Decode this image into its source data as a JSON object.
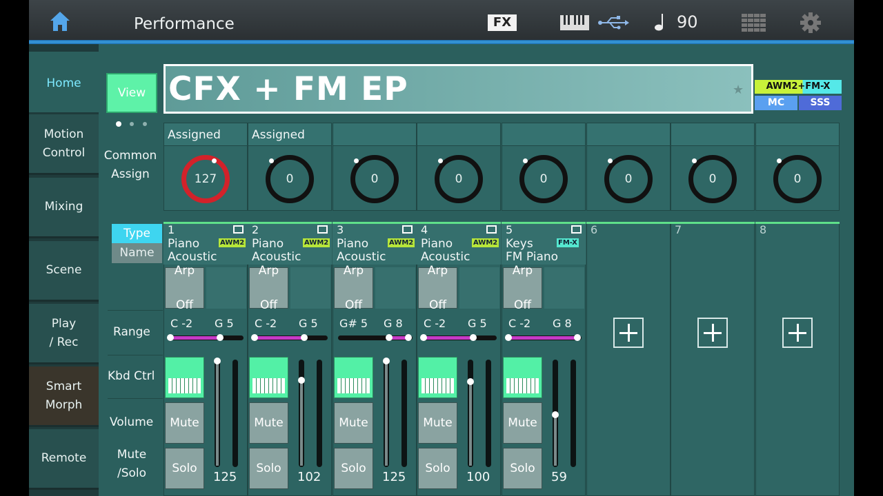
{
  "header": {
    "title": "Performance",
    "fx_label": "FX",
    "tempo_icon": "quarter-note-icon",
    "tempo_value": "90"
  },
  "nav": [
    {
      "label": "Home",
      "active": true
    },
    {
      "label": "Motion\nControl"
    },
    {
      "label": "Mixing"
    },
    {
      "label": "Scene"
    },
    {
      "label": "Play\n/ Rec"
    },
    {
      "label": "Smart\nMorph"
    },
    {
      "label": "Remote"
    }
  ],
  "view_button": "View",
  "performance_name": "CFX + FM EP",
  "engine_badges": {
    "line1": "AWM2+FM-X",
    "mc": "MC",
    "sss": "SSS"
  },
  "row_labels": {
    "common_assign": "Common\nAssign",
    "type": "Type",
    "name": "Name",
    "range": "Range",
    "kbd_ctrl": "Kbd Ctrl",
    "volume": "Volume",
    "mute_solo": "Mute\n/Solo"
  },
  "knobs": [
    {
      "assigned": "Assigned",
      "value": "127"
    },
    {
      "assigned": "Assigned",
      "value": "0"
    },
    {
      "assigned": "",
      "value": "0"
    },
    {
      "assigned": "",
      "value": "0"
    },
    {
      "assigned": "",
      "value": "0"
    },
    {
      "assigned": "",
      "value": "0"
    },
    {
      "assigned": "",
      "value": "0"
    },
    {
      "assigned": "",
      "value": "0"
    }
  ],
  "parts": [
    {
      "num": "1",
      "category": "Piano",
      "sub": "Acoustic",
      "engine": "AWM2",
      "arp_line1": "Arp",
      "arp_line2": "Off",
      "range_low": "C -2",
      "range_high": "G 5",
      "mute": "Mute",
      "solo": "Solo",
      "volume": "125",
      "volume_level": 125
    },
    {
      "num": "2",
      "category": "Piano",
      "sub": "Acoustic",
      "engine": "AWM2",
      "arp_line1": "Arp",
      "arp_line2": "Off",
      "range_low": "C -2",
      "range_high": "G 5",
      "mute": "Mute",
      "solo": "Solo",
      "volume": "102",
      "volume_level": 102
    },
    {
      "num": "3",
      "category": "Piano",
      "sub": "Acoustic",
      "engine": "AWM2",
      "arp_line1": "Arp",
      "arp_line2": "Off",
      "range_low": "G# 5",
      "range_high": "G 8",
      "mute": "Mute",
      "solo": "Solo",
      "volume": "125",
      "volume_level": 125
    },
    {
      "num": "4",
      "category": "Piano",
      "sub": "Acoustic",
      "engine": "AWM2",
      "arp_line1": "Arp",
      "arp_line2": "Off",
      "range_low": "C -2",
      "range_high": "G 5",
      "mute": "Mute",
      "solo": "Solo",
      "volume": "100",
      "volume_level": 100
    },
    {
      "num": "5",
      "category": "Keys",
      "sub": "FM Piano",
      "engine": "FM-X",
      "arp_line1": "Arp",
      "arp_line2": "Off",
      "range_low": "C -2",
      "range_high": "G 8",
      "mute": "Mute",
      "solo": "Solo",
      "volume": "59",
      "volume_level": 59
    }
  ],
  "empty_parts": [
    "6",
    "7",
    "8"
  ],
  "colors": {
    "accent_cyan": "#44d8f0",
    "kbd_green": "#53f0a6",
    "knob_red": "#d2222a"
  }
}
